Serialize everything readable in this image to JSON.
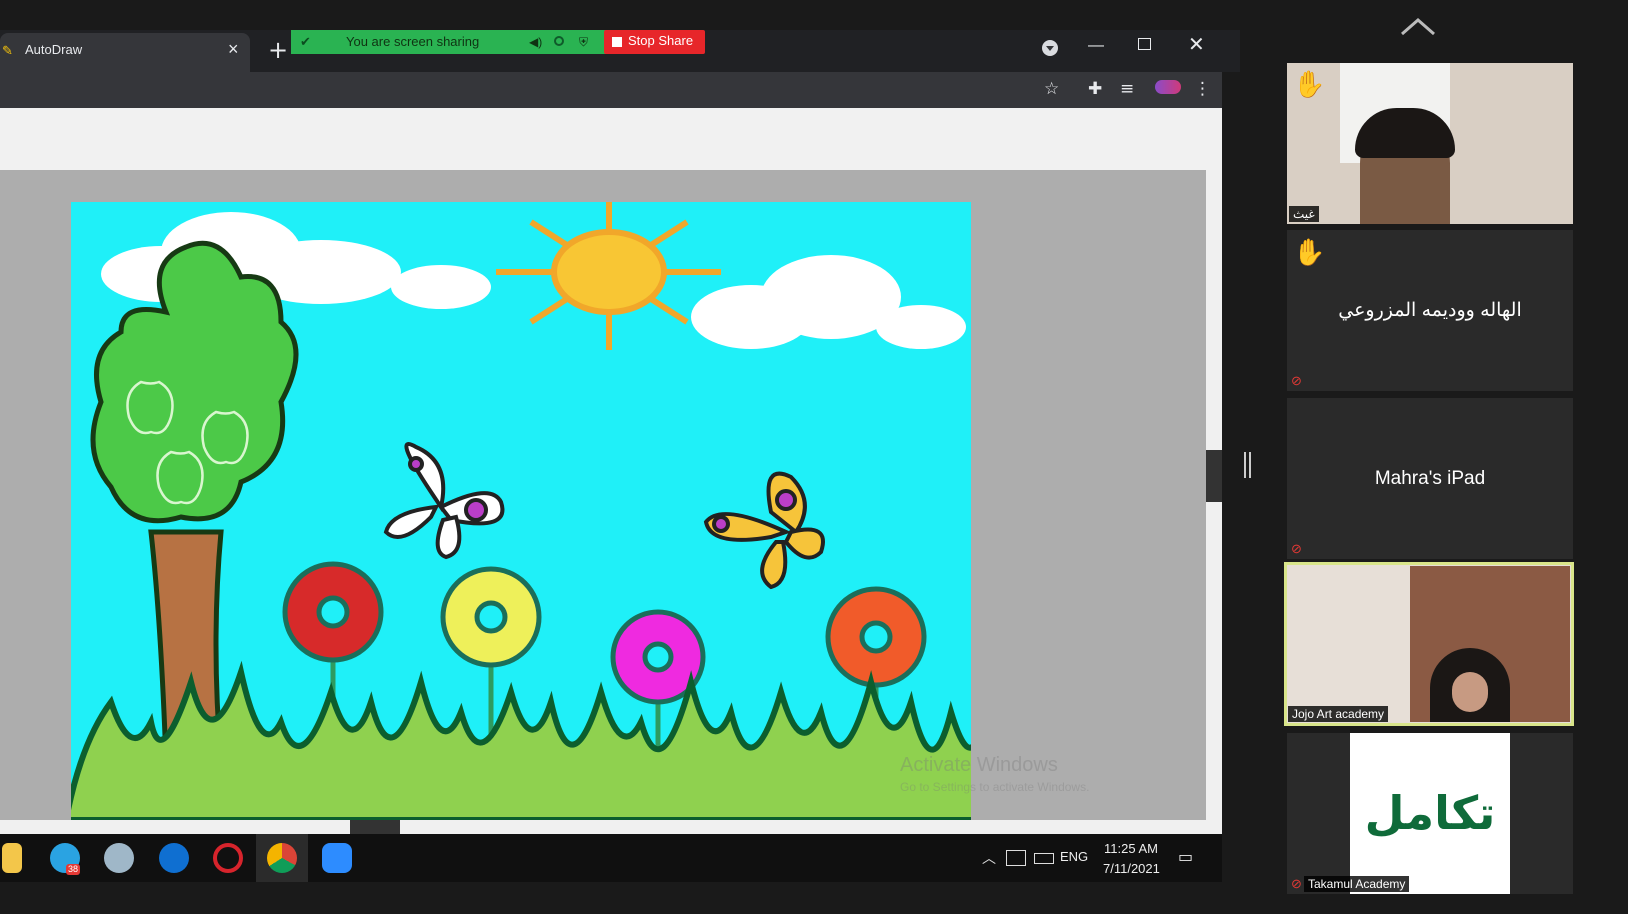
{
  "browser": {
    "tab_title": "AutoDraw",
    "tab_close": "×",
    "new_tab": "+",
    "window_min": "—",
    "window_close": "✕",
    "bookmark_icon": "star-icon",
    "extensions_icon": "puzzle-icon",
    "media_icon": "media-queue-icon",
    "menu_icon": "more-vert-icon"
  },
  "share_bar": {
    "status": "You are screen sharing",
    "stop_label": "Stop Share",
    "accent": "#2ab352",
    "stop_color": "#e7262a"
  },
  "watermark": {
    "line1": "Activate Windows",
    "line2": "Go to Settings to activate Windows."
  },
  "taskbar": {
    "apps": [
      "file-explorer-icon",
      "telegram-icon",
      "paint-icon",
      "edge-icon",
      "opera-icon",
      "chrome-icon",
      "zoom-icon"
    ],
    "telegram_badge": "38",
    "lang": "ENG",
    "time": "11:25 AM",
    "date": "7/11/2021"
  },
  "participants": [
    {
      "name": "غيث",
      "video": true,
      "raised_hand": true
    },
    {
      "name": "الهاله ووديمه المزروعي",
      "video": false,
      "raised_hand": true,
      "muted": true
    },
    {
      "name": "Mahra's iPad",
      "video": false,
      "muted": true
    },
    {
      "name": "Jojo Art academy",
      "video": true,
      "active_speaker": true,
      "highlight": "#d9e58a"
    },
    {
      "name": "Takamul Academy",
      "video": true,
      "muted": true,
      "logo_text": "تكامل"
    }
  ]
}
